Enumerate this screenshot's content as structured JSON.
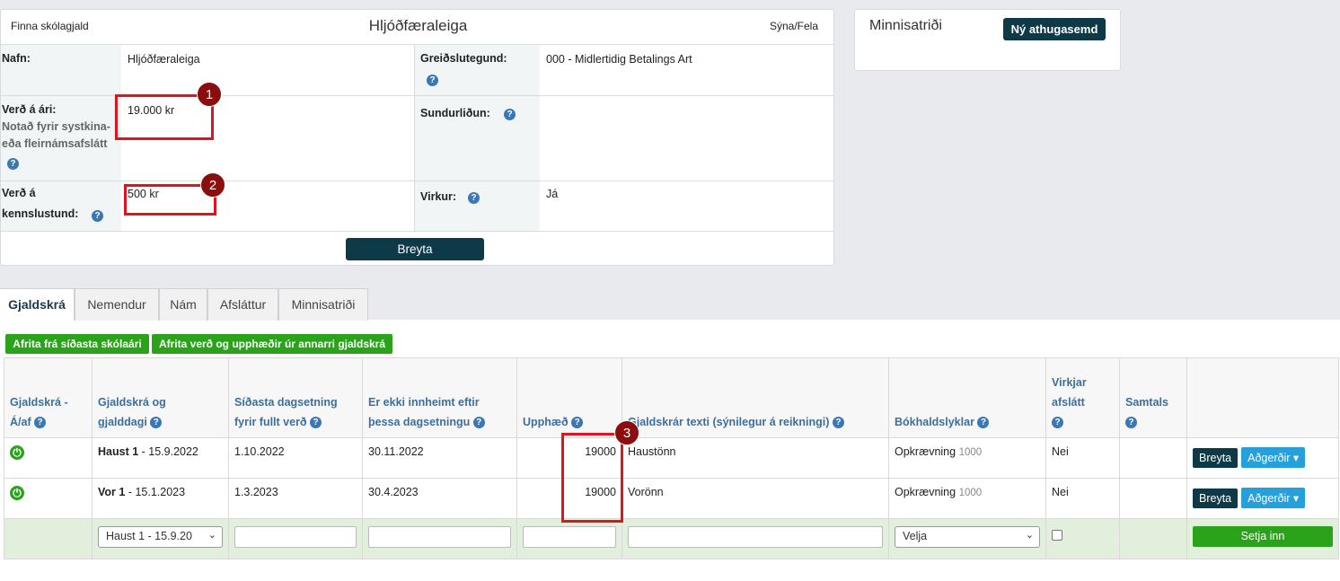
{
  "header": {
    "left_link": "Finna skólagjald",
    "title": "Hljóðfæraleiga",
    "right_link": "Sýna/Fela"
  },
  "details": {
    "nafn_label": "Nafn:",
    "nafn_value": "Hljóðfæraleiga",
    "greidslutegund_label": "Greiðslutegund:",
    "greidslutegund_value": "000 - Midlertidig Betalings Art",
    "verd_ari_label": "Verð á ári:",
    "verd_ari_sub1": "Notað fyrir systkina-",
    "verd_ari_sub2": "eða fleirnámsafslátt",
    "verd_ari_value": "19.000 kr",
    "sundurlidun_label": "Sundurliðun:",
    "verd_kennslu_label1": "Verð á",
    "verd_kennslu_label2": "kennslustund:",
    "verd_kennslu_value": "500 kr",
    "virkur_label": "Virkur:",
    "virkur_value": "Já",
    "edit_button": "Breyta"
  },
  "notes": {
    "title": "Minnisatriði",
    "new_button": "Ný athugasemd"
  },
  "markers": [
    "1",
    "2",
    "3"
  ],
  "tabs": [
    "Gjaldskrá",
    "Nemendur",
    "Nám",
    "Afsláttur",
    "Minnisatriði"
  ],
  "actions": {
    "copy_prev": "Afrita frá síðasta skólaári",
    "copy_other": "Afrita verð og upphæðir úr annarri gjaldskrá"
  },
  "table": {
    "headers": {
      "c1a": "Gjaldskrá -",
      "c1b": "Á/af",
      "c2a": "Gjaldskrá og",
      "c2b": "gjalddagi",
      "c3a": "Síðasta dagsetning",
      "c3b": "fyrir fullt verð",
      "c4a": "Er ekki innheimt eftir",
      "c4b": "þessa dagsetningu",
      "c5": "Upphæð",
      "c6": "Gjaldskrár texti (sýnilegur á reikningi)",
      "c7": "Bókhaldslyklar",
      "c8a": "Virkjar",
      "c8b": "afslátt",
      "c9": "Samtals"
    },
    "rows": [
      {
        "name_bold": "Haust 1",
        "name_rest": " - 15.9.2022",
        "last_date": "1.10.2022",
        "not_after": "30.11.2022",
        "amount": "19000",
        "text": "Haustönn",
        "account": "Opkrævning",
        "account_code": "1000",
        "discount": "Nei",
        "edit": "Breyta",
        "actions": "Aðgerðir"
      },
      {
        "name_bold": "Vor 1",
        "name_rest": " - 15.1.2023",
        "last_date": "1.3.2023",
        "not_after": "30.4.2023",
        "amount": "19000",
        "text": "Vorönn",
        "account": "Opkrævning",
        "account_code": "1000",
        "discount": "Nei",
        "edit": "Breyta",
        "actions": "Aðgerðir"
      }
    ],
    "add_row": {
      "period_select": "Haust 1 - 15.9.20",
      "account_select": "Velja",
      "submit": "Setja inn"
    }
  },
  "colors": {
    "dark_button": "#0e3a48",
    "green_button": "#2aa31b",
    "blue_button": "#26a0da",
    "annotation_red": "#e0141e",
    "marker": "#8a0e0e"
  }
}
